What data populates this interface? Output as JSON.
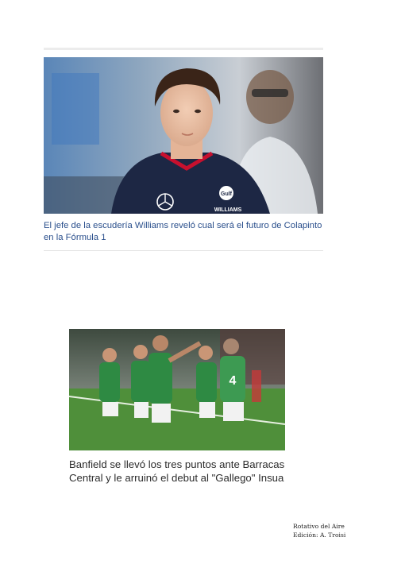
{
  "articles": [
    {
      "image_alt": "Franco Colapinto con remera de Williams",
      "headline": "El jefe de la escudería Williams reveló cual será el futuro de Colapinto en la Fórmula 1",
      "headline_color": "#2a4f8c",
      "shirt_text": "WILLIAMS",
      "sponsor_text": "Gulf"
    },
    {
      "image_alt": "Jugadores de Banfield celebrando un gol",
      "headline": "Banfield se llevó los tres puntos ante Barracas Central y le arruinó el debut al \"Gallego\" Insua",
      "headline_color": "#2b2b2b",
      "jersey_number": "4"
    }
  ],
  "footer": {
    "line1": "Rotativo del Aire",
    "line2": "Edición: A. Troisi"
  }
}
